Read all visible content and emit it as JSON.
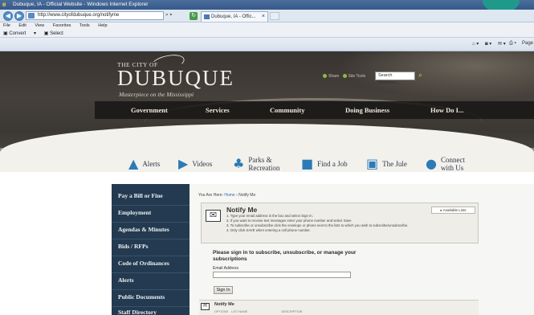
{
  "browser": {
    "window_title": "Dubuque, IA - Official Website - Windows Internet Explorer",
    "url": "http://www.cityofdubuque.org/notifyme",
    "tab_title": "Dubuque, IA - Offic...",
    "tab_close": "×",
    "menu": [
      "File",
      "Edit",
      "View",
      "Favorites",
      "Tools",
      "Help"
    ],
    "favorites": [
      {
        "label": "Convert"
      },
      {
        "label": "Select"
      }
    ],
    "command_bar": [
      "Page"
    ]
  },
  "site": {
    "logo_small": "THE CITY OF",
    "logo_main": "DUBUQUE",
    "tagline": "Masterpiece on the Mississippi",
    "util_links": [
      "Share",
      "Site Tools"
    ],
    "search_placeholder": "Search Dubuque...",
    "nav": [
      "Government",
      "Services",
      "Community",
      "Doing Business",
      "How Do I..."
    ],
    "quick_links": [
      {
        "label": "Alerts",
        "icon": "warning-icon"
      },
      {
        "label": "Videos",
        "icon": "play-icon"
      },
      {
        "label": "Parks &\nRecreation",
        "icon": "tree-icon"
      },
      {
        "label": "Find a Job",
        "icon": "briefcase-icon"
      },
      {
        "label": "The Jule",
        "icon": "bus-icon"
      },
      {
        "label": "Connect\nwith Us",
        "icon": "person-plus-icon"
      }
    ],
    "sidebar": [
      "Pay a Bill or Fine",
      "Employment",
      "Agendas & Minutes",
      "Bids / RFPs",
      "Code of Ordinances",
      "Alerts",
      "Public Documents",
      "Staff Directory"
    ]
  },
  "content": {
    "breadcrumb_prefix": "You Are Here:",
    "breadcrumb_home": "Home",
    "breadcrumb_sep": "›",
    "breadcrumb_current": "Notify Me",
    "notify_title": "Notify Me",
    "steps": [
      "1.  Type your email address in the box and select Sign In.",
      "2.  If you want to receive text messages enter your phone number and select Save",
      "3.  To subscribe or unsubscribe click the envelope or phone next to the lists to which you wish to subscribe/unsubscribe.",
      "4.  Only click SAVE when entering a cell phone number."
    ],
    "available_lists_button": "▸ Available Lists",
    "signin_heading": "Please sign in to subscribe, unsubscribe, or manage your subscriptions",
    "email_label": "Email Address",
    "signin_button": "Sign In",
    "bottom_title": "Notify Me",
    "bottom_columns": "OPTIONS    LIST NAME                                        DESCRIPTION"
  }
}
